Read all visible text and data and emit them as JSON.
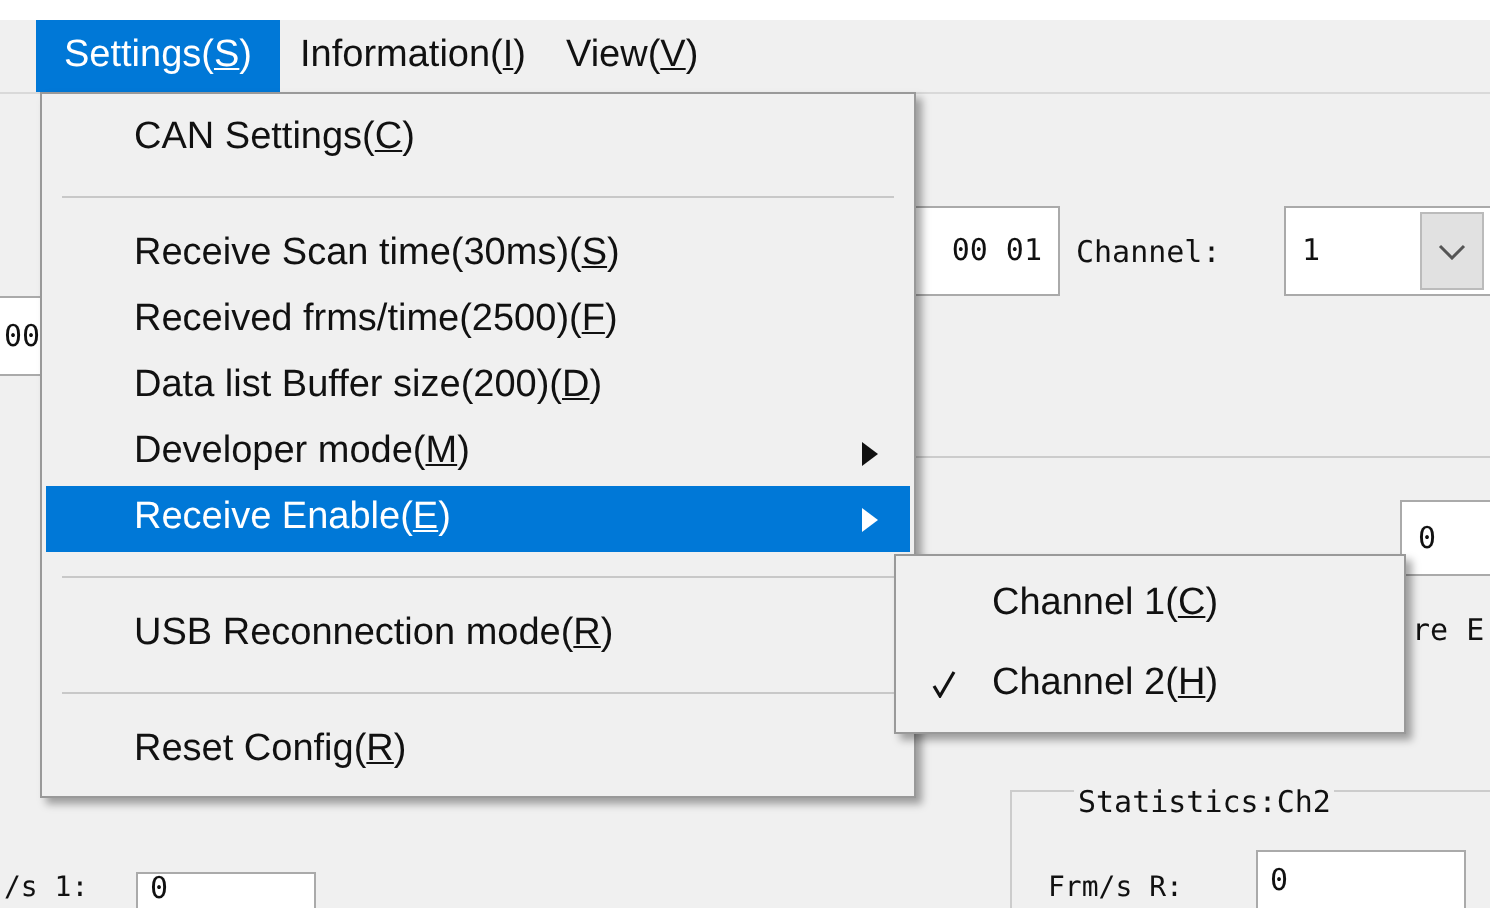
{
  "menubar": [
    {
      "label": "Settings(S)",
      "selected": true
    },
    {
      "label": "Information(I)",
      "selected": false
    },
    {
      "label": "View(V)",
      "selected": false
    }
  ],
  "background": {
    "id_field_value": "00 01",
    "channel_label": "Channel:",
    "channel_value": "1",
    "left_field_value": "00",
    "speed_value": "0",
    "partial_label": "re E",
    "statistics_title": "Statistics:Ch2",
    "frm_label": "Frm/s R:",
    "frm_value": "0",
    "bottom_label": "/s 1:",
    "bottom_value": "0"
  },
  "menu": {
    "items": [
      {
        "kind": "item",
        "label": "CAN Settings(C)",
        "selected": false,
        "submenu": false
      },
      {
        "kind": "separator"
      },
      {
        "kind": "item",
        "label": "Receive Scan time(30ms)(S)",
        "selected": false,
        "submenu": false
      },
      {
        "kind": "item",
        "label": "Received frms/time(2500)(F)",
        "selected": false,
        "submenu": false
      },
      {
        "kind": "item",
        "label": "Data list Buffer size(200)(D)",
        "selected": false,
        "submenu": false
      },
      {
        "kind": "item",
        "label": "Developer mode(M)",
        "selected": false,
        "submenu": true
      },
      {
        "kind": "item",
        "label": "Receive Enable(E)",
        "selected": true,
        "submenu": true
      },
      {
        "kind": "separator"
      },
      {
        "kind": "item",
        "label": "USB Reconnection mode(R)",
        "selected": false,
        "submenu": false
      },
      {
        "kind": "separator"
      },
      {
        "kind": "item",
        "label": "Reset Config(R)",
        "selected": false,
        "submenu": false
      }
    ]
  },
  "submenu": {
    "items": [
      {
        "label": "Channel 1(C)",
        "checked": false
      },
      {
        "label": "Channel 2(H)",
        "checked": true
      }
    ]
  }
}
